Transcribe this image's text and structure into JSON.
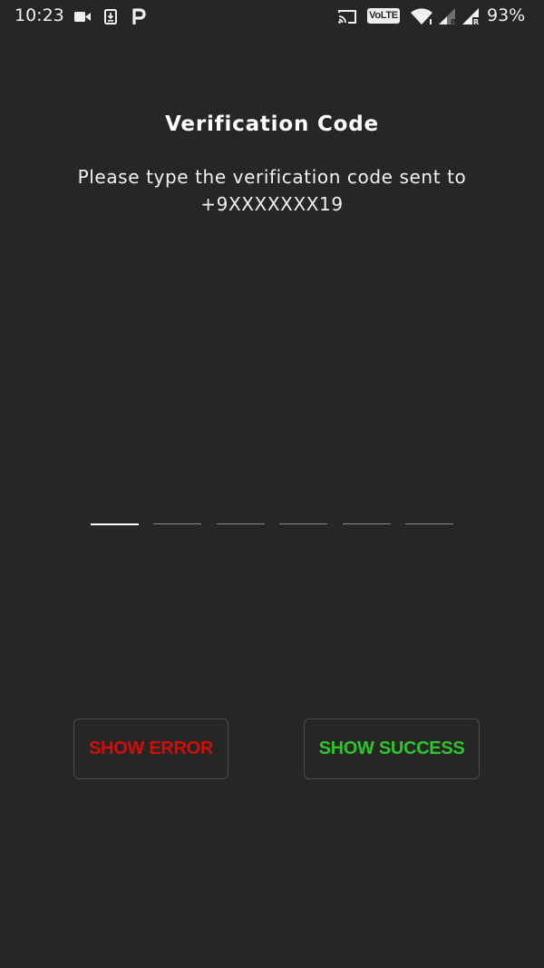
{
  "status_bar": {
    "time": "10:23",
    "network_badge": "VoLTE",
    "battery_percent": "93%",
    "icons": [
      "video-camera-icon",
      "download-notification-icon",
      "parking-app-icon",
      "cast-icon",
      "volte-icon",
      "wifi-icon",
      "signal-roaming-icon",
      "signal-roaming-icon"
    ]
  },
  "verification": {
    "title": "Verification Code",
    "subtitle_line1": "Please type the verification code sent to",
    "subtitle_line2": "+9XXXXXXX19",
    "code_slots": [
      "",
      "",
      "",
      "",
      "",
      ""
    ],
    "active_slot": 1
  },
  "buttons": {
    "show_error": "SHOW ERROR",
    "show_success": "SHOW SUCCESS"
  },
  "colors": {
    "background": "#262725",
    "error": "#d20b0b",
    "success": "#2ec52a"
  }
}
